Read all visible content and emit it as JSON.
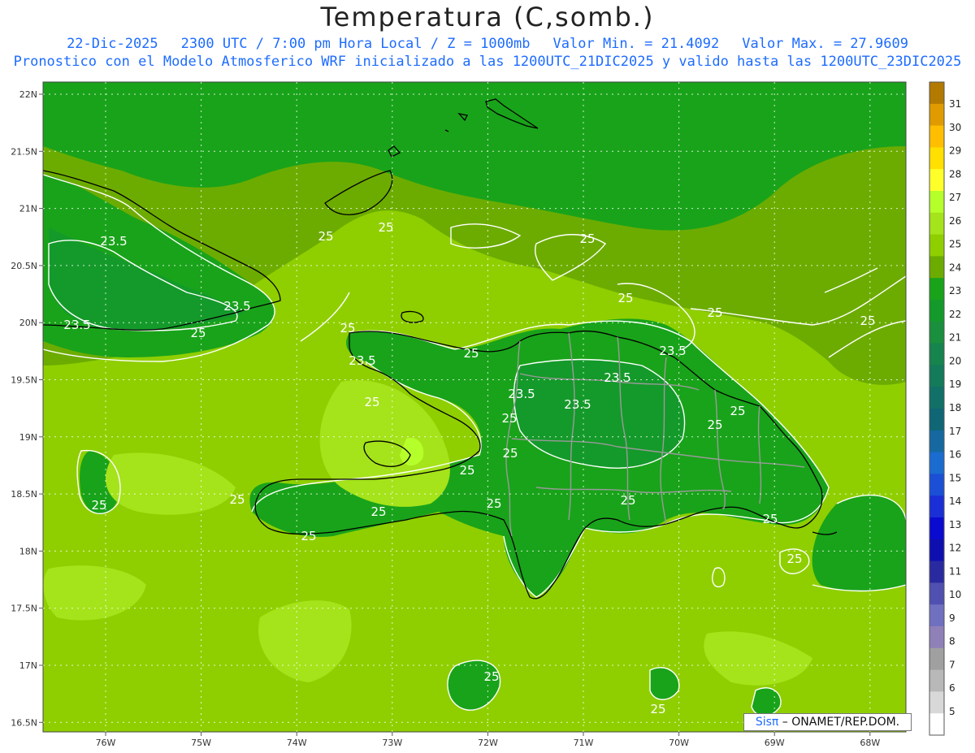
{
  "header": {
    "title": "Temperatura (C,somb.)",
    "date": "22-Dic-2025",
    "time": "2300 UTC / 7:00 pm Hora Local / Z = 1000mb",
    "valor_min": "Valor Min. = 21.4092",
    "valor_max": "Valor Max. = 27.9609",
    "description": "Pronostico con el Modelo Atmosferico WRF inicializado a las 1200UTC_21DIC2025 y valido hasta las  1200UTC_23DIC2025"
  },
  "axes": {
    "lat_labels": [
      "22N",
      "21.5N",
      "21N",
      "20.5N",
      "20N",
      "19.5N",
      "19N",
      "18.5N",
      "18N",
      "17.5N",
      "17N",
      "16.5N"
    ],
    "lon_labels": [
      "76W",
      "75W",
      "74W",
      "73W",
      "72W",
      "71W",
      "70W",
      "69W",
      "68W"
    ]
  },
  "colorbar": {
    "labels": [
      "31",
      "30",
      "29",
      "28",
      "27",
      "26",
      "25",
      "24",
      "23",
      "22",
      "21",
      "20",
      "19",
      "18",
      "17",
      "16",
      "15",
      "14",
      "13",
      "12",
      "11",
      "10",
      "9",
      "8",
      "7",
      "6",
      "5"
    ],
    "colors": [
      "#b27a00",
      "#e09b00",
      "#ffbf00",
      "#ffe000",
      "#ffff2a",
      "#b5ff2a",
      "#a5e31a",
      "#8fcf00",
      "#6cac00",
      "#19a31a",
      "#149a2a",
      "#1a8f3d",
      "#16844d",
      "#137a5a",
      "#117067",
      "#0f6674",
      "#1569a0",
      "#1a6cd0",
      "#1a4fd6",
      "#1a2fd6",
      "#0a0ad0",
      "#0f0fb0",
      "#2a2aa0",
      "#5050b0",
      "#7070c0",
      "#9080b8",
      "#a0a0a0",
      "#b8b8b8",
      "#d8d8d8",
      "#ffffff"
    ]
  },
  "contour_labels": [
    "23.5",
    "23.5",
    "23.5",
    "23.5",
    "23.5",
    "23.5",
    "23.5",
    "23.5",
    "25",
    "25",
    "25",
    "25",
    "25",
    "25",
    "25",
    "25",
    "25",
    "25",
    "25",
    "25",
    "25",
    "25",
    "25",
    "25",
    "25",
    "25",
    "25",
    "25",
    "25",
    "25"
  ],
  "logo": {
    "sis": "Sisπ",
    "org": " – ONAMET/REP.DOM."
  },
  "colors": {
    "ocean_green": "#8fcf00",
    "mid_green": "#6cac00",
    "land_green": "#19a31a",
    "dark_green": "#149a2a",
    "light_green": "#a5e31a",
    "lime": "#b5ff2a",
    "header_blue": "#1e6cff"
  }
}
